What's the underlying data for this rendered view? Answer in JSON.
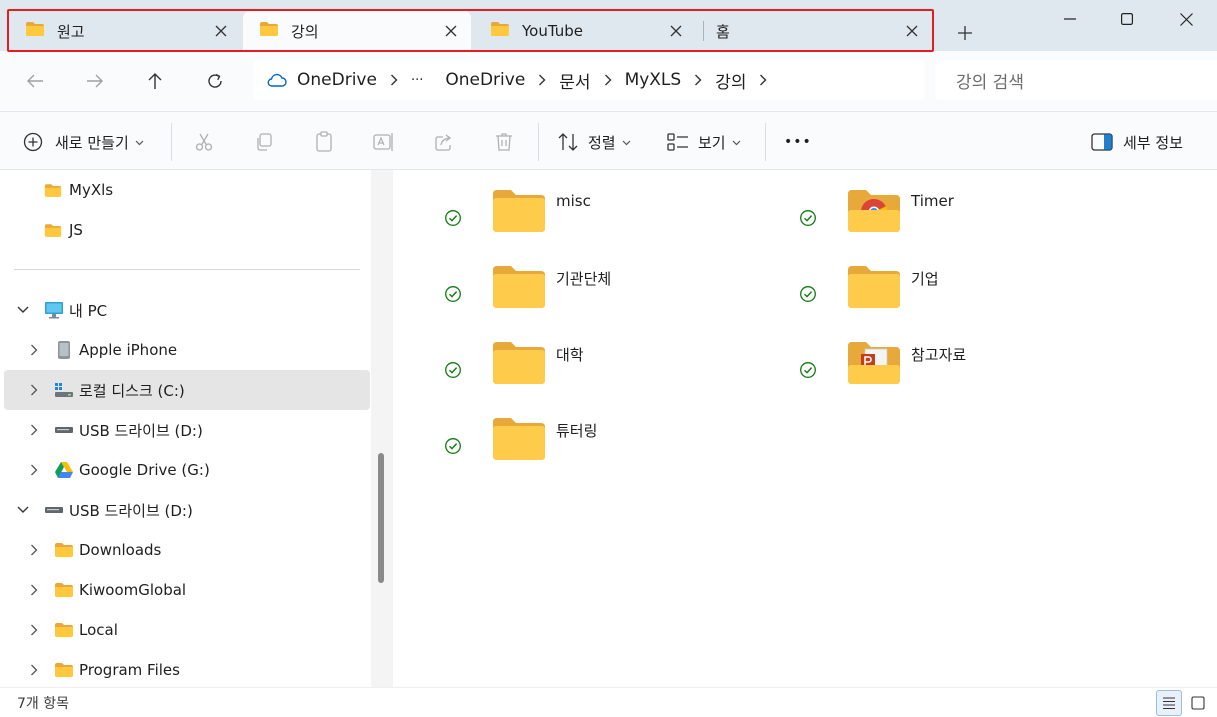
{
  "tabs": [
    {
      "label": "원고",
      "active": false
    },
    {
      "label": "강의",
      "active": true
    },
    {
      "label": "YouTube",
      "active": false
    },
    {
      "label": "홈",
      "active": false
    }
  ],
  "breadcrumb": {
    "cloud_label": "OneDrive",
    "ellipsis": "···",
    "items": [
      "OneDrive",
      "문서",
      "MyXLS",
      "강의"
    ]
  },
  "search": {
    "placeholder": "강의 검색"
  },
  "commands": {
    "new": "새로 만들기",
    "sort": "정렬",
    "view": "보기",
    "more": "•••",
    "details": "세부 정보"
  },
  "nav": {
    "items": [
      {
        "label": "MyXls"
      },
      {
        "label": "JS"
      },
      {
        "label": "내 PC"
      },
      {
        "label": "Apple iPhone"
      },
      {
        "label": "로컬 디스크 (C:)"
      },
      {
        "label": "USB 드라이브 (D:)"
      },
      {
        "label": "Google Drive (G:)"
      },
      {
        "label": "USB 드라이브 (D:)"
      },
      {
        "label": "Downloads"
      },
      {
        "label": "KiwoomGlobal"
      },
      {
        "label": "Local"
      },
      {
        "label": "Program Files"
      }
    ]
  },
  "folders": [
    {
      "name": "misc",
      "icon": "folder-icon"
    },
    {
      "name": "Timer",
      "icon": "folder-chrome-icon"
    },
    {
      "name": "기관단체",
      "icon": "folder-icon"
    },
    {
      "name": "기업",
      "icon": "folder-icon"
    },
    {
      "name": "대학",
      "icon": "folder-icon"
    },
    {
      "name": "참고자료",
      "icon": "folder-ppt-icon"
    },
    {
      "name": "튜터링",
      "icon": "folder-icon"
    }
  ],
  "status": {
    "count": "7개 항목"
  },
  "colors": {
    "accent": "#0067c0",
    "sync_green": "#0f7b0f",
    "folder": "#ffc83d",
    "highlight": "#e51d23"
  }
}
